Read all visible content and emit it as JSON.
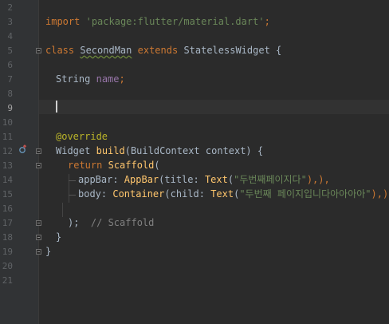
{
  "gutter": {
    "line_numbers": [
      "2",
      "3",
      "4",
      "5",
      "6",
      "7",
      "8",
      "9",
      "10",
      "11",
      "12",
      "13",
      "14",
      "15",
      "16",
      "17",
      "18",
      "19",
      "20",
      "21"
    ],
    "current_line": "9"
  },
  "code": {
    "line3": {
      "kw_import": "import",
      "sp": " ",
      "str": "'package:flutter/material.dart'",
      "semi": ";"
    },
    "line5": {
      "kw_class": "class",
      "name": "SecondMan",
      "kw_extends": "extends",
      "base": "StatelessWidget",
      "brace": " {"
    },
    "line7": {
      "type": "String",
      "field": "name",
      "semi": ";"
    },
    "line11": {
      "annotation": "@override"
    },
    "line12": {
      "ret_type": "Widget",
      "method": "build",
      "params": "(BuildContext context) {"
    },
    "line13": {
      "kw_return": "return",
      "scaffold": "Scaffold",
      "paren": "("
    },
    "line14": {
      "prop": "appBar: ",
      "appbar": "AppBar",
      "args_open": "(title: ",
      "text": "Text",
      "p_open": "(",
      "str": "\"두번째페이지다\"",
      "tail": "),",
      "comma": "),"
    },
    "line15": {
      "prop": "body: ",
      "container": "Container",
      "args_open": "(child: ",
      "text": "Text",
      "p_open": "(",
      "str": "\"두번째 페이지입니다아아아아\"",
      "tail": "),",
      "comma": "),"
    },
    "line17": {
      "close": ");",
      "comment": "// Scaffold"
    },
    "line18": {
      "close": "}"
    },
    "line19": {
      "close": "}"
    }
  },
  "icons": {
    "override_icon": "override-gutter-icon"
  },
  "colors": {
    "background": "#2b2b2b",
    "keyword": "#cc7832",
    "string": "#6a8759",
    "annotation": "#bbb529",
    "class_name": "#ffc66d",
    "field": "#9876aa",
    "comment": "#808080",
    "text": "#a9b7c6"
  }
}
